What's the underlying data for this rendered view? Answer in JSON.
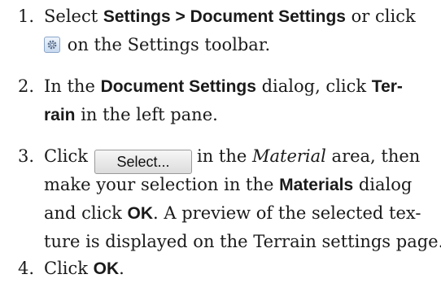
{
  "steps": [
    {
      "number": "1.",
      "lines": [
        [
          "Select ",
          "Settings > Document Settings",
          " or click"
        ],
        [
          "on the Settings toolbar."
        ]
      ]
    },
    {
      "number": "2.",
      "lines": [
        [
          "In the ",
          "Document Settings",
          " dialog, click ",
          "Ter-"
        ],
        [
          "rain",
          " in the left pane."
        ]
      ]
    },
    {
      "number": "3.",
      "button_label": "Select...",
      "lines": [
        [
          "Click",
          "in the ",
          "Material",
          " area, then"
        ],
        [
          "make your selection in the ",
          "Materials",
          " dialog"
        ],
        [
          "and click ",
          "OK",
          ". A preview of the selected tex-"
        ],
        [
          "ture is displayed on the Terrain settings page."
        ]
      ]
    },
    {
      "number": "4.",
      "lines": [
        [
          "Click ",
          "OK",
          "."
        ]
      ]
    }
  ],
  "icons": {
    "settings": "gear-icon"
  }
}
